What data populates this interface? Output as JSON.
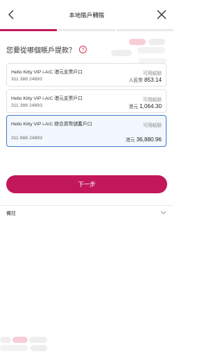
{
  "header": {
    "title": "本地賬戶轉賬"
  },
  "progress": {
    "current_step": 1,
    "total_steps": 3
  },
  "question": {
    "text": "您要從哪個賬戶提款？",
    "help_icon": "?"
  },
  "accounts": [
    {
      "name": "Hello Kitty VIP i-A/C 港元支票戶口",
      "number": "311 388 24893",
      "available_label": "可用結餘",
      "currency": "人民幣",
      "amount": "853.14",
      "selected": false
    },
    {
      "name": "Hello Kitty VIP i-A/C 港元支票戶口",
      "number": "311 388 24893",
      "available_label": "可用結餘",
      "currency": "港元",
      "amount": "1,064.30",
      "selected": false
    },
    {
      "name": "Hello Kitty VIP i-A/C 綜合貨幣儲蓄戶口",
      "number": "311 888 24893",
      "available_label": "可用結餘",
      "currency": "港元",
      "amount": "36,880.96",
      "selected": true
    }
  ],
  "next_button": {
    "label": "下一步"
  },
  "remark": {
    "label": "備註"
  },
  "colors": {
    "brand": "#c2185b",
    "selected_border": "#3c78c8",
    "selected_bg": "#f3f8ff"
  },
  "icons": {
    "back": "chevron-left-icon",
    "close": "close-icon",
    "help": "question-circle-icon",
    "expand": "chevron-down-icon"
  }
}
